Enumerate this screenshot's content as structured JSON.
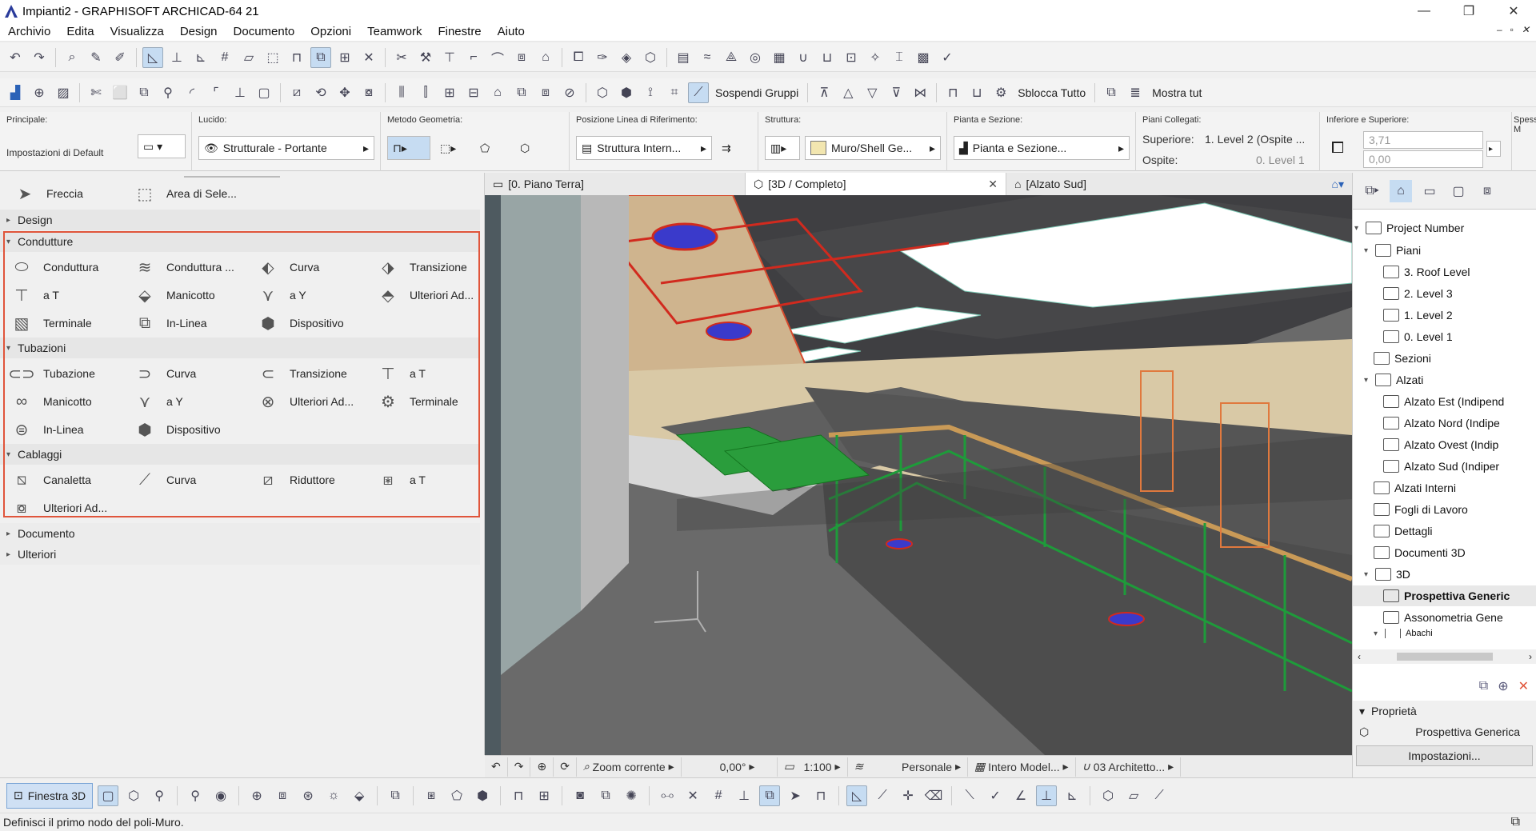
{
  "window": {
    "title": "Impianti2 - GRAPHISOFT ARCHICAD-64 21",
    "controls": [
      "—",
      "❐",
      "✕"
    ],
    "mdi_controls": [
      "‒",
      "▫",
      "✕"
    ]
  },
  "menu": [
    "Archivio",
    "Edita",
    "Visualizza",
    "Design",
    "Documento",
    "Opzioni",
    "Teamwork",
    "Finestre",
    "Aiuto"
  ],
  "toolbar2": {
    "sospendi": "Sospendi Gruppi",
    "sblocca": "Sblocca Tutto",
    "mostra": "Mostra tut"
  },
  "infobox": {
    "principale_label": "Principale:",
    "principale_value": "Impostazioni di Default",
    "lucido_label": "Lucido:",
    "lucido_value": "Strutturale - Portante",
    "metodo_label": "Metodo Geometria:",
    "posizione_label": "Posizione Linea di Riferimento:",
    "posizione_value": "Struttura Intern...",
    "struttura_label": "Struttura:",
    "struttura_value": "Muro/Shell Ge...",
    "pianta_label": "Pianta e Sezione:",
    "pianta_value": "Pianta e Sezione...",
    "piani_label": "Piani Collegati:",
    "superiore_label": "Superiore:",
    "superiore_value": "1. Level 2 (Ospite ...",
    "ospite_label": "Ospite:",
    "ospite_value": "0. Level 1",
    "inf_sup_label": "Inferiore e Superiore:",
    "inf_sup_top": "3,71",
    "inf_sup_bottom": "0,00",
    "spessore_label": "Spessore M"
  },
  "toolbox": {
    "freccia": "Freccia",
    "area": "Area di Sele...",
    "design": "Design",
    "condutture": {
      "header": "Condutture",
      "items": [
        "Conduttura",
        "Conduttura ...",
        "Curva",
        "Transizione",
        "a T",
        "Manicotto",
        "a Y",
        "Ulteriori Ad...",
        "Terminale",
        "In-Linea",
        "Dispositivo"
      ]
    },
    "tubazioni": {
      "header": "Tubazioni",
      "items": [
        "Tubazione",
        "Curva",
        "Transizione",
        "a T",
        "Manicotto",
        "a Y",
        "Ulteriori Ad...",
        "Terminale",
        "In-Linea",
        "Dispositivo"
      ]
    },
    "cablaggi": {
      "header": "Cablaggi",
      "items": [
        "Canaletta",
        "Curva",
        "Riduttore",
        "a T",
        "Ulteriori Ad..."
      ]
    },
    "documento": "Documento",
    "ulteriori": "Ulteriori"
  },
  "tabs": [
    "[0. Piano Terra]",
    "[3D / Completo]",
    "[Alzato Sud]"
  ],
  "view_status": {
    "zoom": "Zoom corrente",
    "angle": "0,00°",
    "scale": "1:100",
    "personale": "Personale",
    "model": "Intero Model...",
    "archi": "03 Architetto..."
  },
  "navigator": {
    "root": "Project Number",
    "nodes": [
      "Piani",
      "3. Roof Level",
      "2. Level 3",
      "1. Level 2",
      "0. Level 1",
      "Sezioni",
      "Alzati",
      "Alzato Est (Indipend",
      "Alzato Nord (Indipe",
      "Alzato Ovest (Indip",
      "Alzato Sud (Indiper",
      "Alzati Interni",
      "Fogli di Lavoro",
      "Dettagli",
      "Documenti 3D",
      "3D",
      "Prospettiva Generic",
      "Assonometria Gene",
      "Abachi"
    ]
  },
  "properties": {
    "header": "Proprietà",
    "value": "Prospettiva Generica",
    "button": "Impostazioni..."
  },
  "bottom": {
    "finestra": "Finestra 3D"
  },
  "status": "Definisci il primo nodo del poli-Muro."
}
